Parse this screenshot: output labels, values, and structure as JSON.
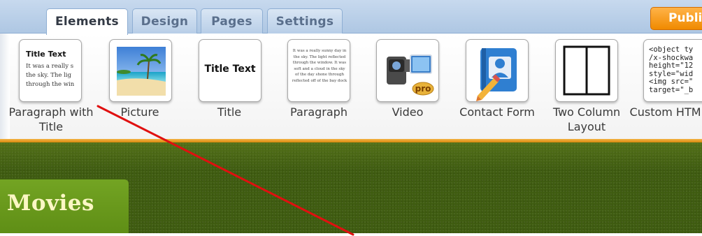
{
  "tabs": [
    {
      "label": "Elements",
      "active": true
    },
    {
      "label": "Design",
      "active": false
    },
    {
      "label": "Pages",
      "active": false
    },
    {
      "label": "Settings",
      "active": false
    }
  ],
  "publish_label": "Publi",
  "elements": [
    {
      "caption": "Paragraph with Title",
      "icon": "paragraph-title-thumb"
    },
    {
      "caption": "Picture",
      "icon": "beach-picture-thumb"
    },
    {
      "caption": "Title",
      "icon": "title-text-thumb"
    },
    {
      "caption": "Paragraph",
      "icon": "paragraph-thumb"
    },
    {
      "caption": "Video",
      "icon": "video-camera-icon"
    },
    {
      "caption": "Contact Form",
      "icon": "address-book-icon"
    },
    {
      "caption": "Two Column Layout",
      "icon": "two-column-icon"
    },
    {
      "caption": "Custom HTML",
      "icon": "html-code-thumb"
    }
  ],
  "thumbs": {
    "para_title": {
      "title": "Title Text",
      "lines": [
        "It was a really s",
        "the sky.  The lig",
        "through the win"
      ]
    },
    "title_text": "Title Text",
    "paragraph_lines": [
      "It was a really sunny day in",
      "the sky.  The light reflected",
      "through the window.  It was",
      "soft and a cloud in the sky",
      "of the day shone through",
      "reflected off of the bay dock"
    ],
    "video_badge": "pro",
    "custom_html_lines": [
      "<object ty",
      "/x-shockwa",
      "height=\"12",
      "style=\"wid",
      "<img src=\"",
      "target=\"_b"
    ]
  },
  "page": {
    "section_title": "Movies"
  },
  "colors": {
    "tab_bar": "#aec7e3",
    "publish": "#f08a00",
    "page_green": "#3f5c10",
    "movies_tab": "#6a9a1e",
    "annotation_line": "#e01010"
  }
}
